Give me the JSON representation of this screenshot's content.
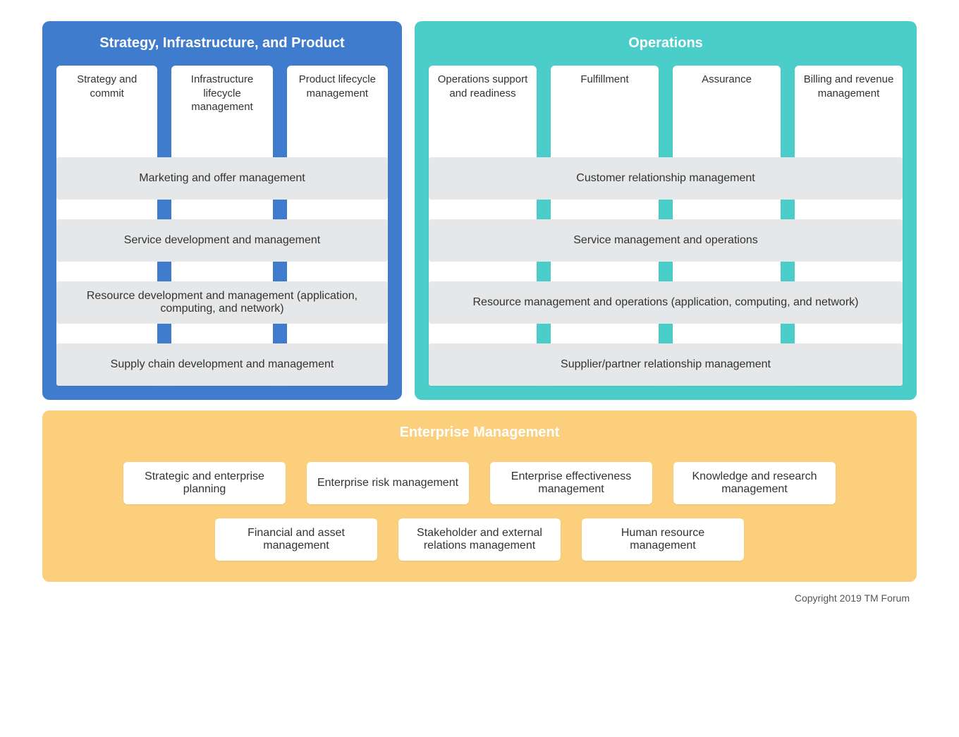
{
  "sip": {
    "title": "Strategy, Infrastructure, and Product",
    "columns": [
      "Strategy and commit",
      "Infrastructure lifecycle management",
      "Product lifecycle management"
    ],
    "rows": [
      "Marketing and offer management",
      "Service development and management",
      "Resource development and management (application, computing, and network)",
      "Supply chain development and management"
    ]
  },
  "ops": {
    "title": "Operations",
    "columns": [
      "Operations support and readiness",
      "Fulfillment",
      "Assurance",
      "Billing and revenue management"
    ],
    "rows": [
      "Customer relationship management",
      "Service management and operations",
      "Resource management and operations (application, computing, and network)",
      "Supplier/partner relationship management"
    ]
  },
  "enterprise": {
    "title": "Enterprise Management",
    "row1": [
      "Strategic and enterprise planning",
      "Enterprise risk management",
      "Enterprise effectiveness management",
      "Knowledge and research management"
    ],
    "row2": [
      "Financial and asset management",
      "Stakeholder and external relations management",
      "Human resource management"
    ]
  },
  "copyright": "Copyright 2019 TM Forum"
}
